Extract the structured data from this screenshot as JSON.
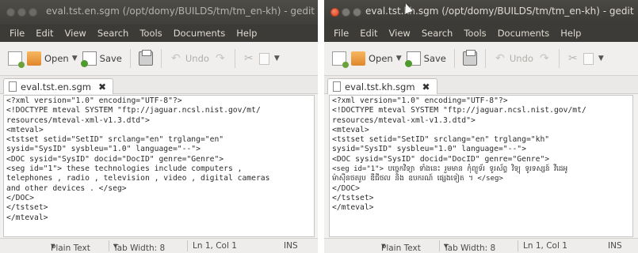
{
  "left_window": {
    "title": "eval.tst.en.sgm (/opt/domy/BUILDS/tm/tm_en-kh) - gedit",
    "menu": [
      "File",
      "Edit",
      "View",
      "Search",
      "Tools",
      "Documents",
      "Help"
    ],
    "toolbar": {
      "open_label": "Open",
      "save_label": "Save",
      "undo_label": "Undo"
    },
    "tab_label": "eval.tst.en.sgm",
    "lines": [
      "<?xml version=\"1.0\" encoding=\"UTF-8\"?>",
      "<!DOCTYPE mteval SYSTEM \"ftp://jaguar.ncsl.nist.gov/mt/",
      "resources/mteval-xml-v1.3.dtd\">",
      "<mteval>",
      "<tstset setid=\"SetID\" srclang=\"en\" trglang=\"en\"",
      "sysid=\"SysID\" sysbleu=\"1.0\" language=\"--\">",
      "<DOC sysid=\"SysID\" docid=\"DocID\" genre=\"Genre\">",
      "<seg id=\"1\"> these technologies include computers ,",
      "telephones , radio , television , video , digital cameras",
      "and other devices . </seg>",
      "</DOC>",
      "</tstset>",
      "</mteval>"
    ],
    "status": {
      "language": "Plain Text",
      "tab_width": "Tab Width: 8",
      "position": "Ln 1, Col 1",
      "mode": "INS"
    }
  },
  "right_window": {
    "title": "eval.tst.kh.sgm (/opt/domy/BUILDS/tm/tm_en-kh) - gedit",
    "menu": [
      "File",
      "Edit",
      "View",
      "Search",
      "Tools",
      "Documents",
      "Help"
    ],
    "toolbar": {
      "open_label": "Open",
      "save_label": "Save",
      "undo_label": "Undo"
    },
    "tab_label": "eval.tst.kh.sgm",
    "lines": [
      "<?xml version=\"1.0\" encoding=\"UTF-8\"?>",
      "<!DOCTYPE mteval SYSTEM \"ftp://jaguar.ncsl.nist.gov/mt/",
      "resources/mteval-xml-v1.3.dtd\">",
      "<mteval>",
      "<tstset setid=\"SetID\" srclang=\"en\" trglang=\"kh\"",
      "sysid=\"SysID\" sysbleu=\"1.0\" language=\"--\">",
      "<DOC sysid=\"SysID\" docid=\"DocID\" genre=\"Genre\">",
      "<seg id=\"1\"> បច្ចេកវិទ្យា ទាំងនេះ រួមមាន កុំព្យូទ័រ ទូរស័ព្ទ វិទ្យុ ទូរទស្សន៍ វីដេអូ",
      "ម៉ាស៊ីនថតរូប ឌីជីថល និង ឧបករណ៍ ផ្សេងទៀត ។ </seg>",
      "</DOC>",
      "</tstset>",
      "</mteval>"
    ],
    "status": {
      "language": "Plain Text",
      "tab_width": "Tab Width: 8",
      "position": "Ln 1, Col 1",
      "mode": "INS"
    }
  }
}
